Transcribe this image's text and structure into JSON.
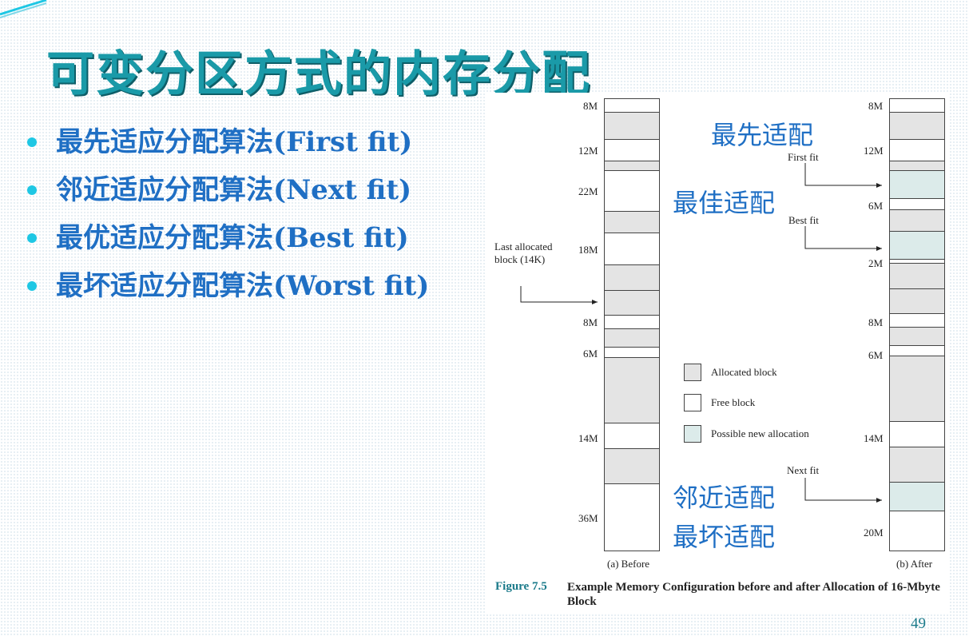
{
  "slide": {
    "title": "可变分区方式的内存分配",
    "page_number": "49",
    "bullets": [
      "最先适应分配算法(First fit)",
      "邻近适应分配算法(Next fit)",
      "最优适应分配算法(Best fit)",
      "最坏适应分配算法(Worst fit)"
    ],
    "overlay_labels": {
      "first": "最先适配",
      "best": "最佳适配",
      "next": "邻近适配",
      "worst": "最坏适配"
    },
    "colors": {
      "title": "#1a9aa8",
      "bullet_text": "#1f6fc4",
      "bullet_dot": "#1ec7e4",
      "allocated": "#e4e4e4",
      "free": "#ffffff",
      "new_allocation": "#dcebea"
    }
  },
  "figure": {
    "caption_number": "Figure 7.5",
    "caption_text": "Example Memory Configuration before and after Allocation of 16-Mbyte Block",
    "before_label": "(a) Before",
    "after_label": "(b) After",
    "last_block_label": "Last allocated block (14K)",
    "arrow_labels": {
      "first_fit": "First fit",
      "best_fit": "Best fit",
      "next_fit": "Next fit"
    },
    "legend": [
      {
        "type": "alloc",
        "label": "Allocated block"
      },
      {
        "type": "free",
        "label": "Free block"
      },
      {
        "type": "newalloc",
        "label": "Possible new allocation"
      }
    ],
    "before_size_labels": [
      "8M",
      "12M",
      "22M",
      "18M",
      "8M",
      "6M",
      "14M",
      "36M"
    ],
    "after_size_labels": [
      "8M",
      "12M",
      "6M",
      "2M",
      "8M",
      "6M",
      "14M",
      "20M"
    ],
    "before_segments": [
      {
        "type": "free",
        "size": "8M"
      },
      {
        "type": "alloc"
      },
      {
        "type": "free",
        "size": "12M"
      },
      {
        "type": "alloc"
      },
      {
        "type": "free",
        "size": "22M"
      },
      {
        "type": "alloc"
      },
      {
        "type": "free",
        "size": "18M"
      },
      {
        "type": "alloc"
      },
      {
        "type": "alloc"
      },
      {
        "type": "free",
        "size": "8M"
      },
      {
        "type": "alloc"
      },
      {
        "type": "free",
        "size": "6M"
      },
      {
        "type": "alloc"
      },
      {
        "type": "free",
        "size": "14M"
      },
      {
        "type": "alloc"
      },
      {
        "type": "free",
        "size": "36M"
      }
    ],
    "after_segments": [
      {
        "type": "free",
        "size": "8M"
      },
      {
        "type": "alloc"
      },
      {
        "type": "free",
        "size": "12M"
      },
      {
        "type": "alloc"
      },
      {
        "type": "newalloc"
      },
      {
        "type": "free",
        "size": "6M"
      },
      {
        "type": "alloc"
      },
      {
        "type": "newalloc"
      },
      {
        "type": "free",
        "size": "2M"
      },
      {
        "type": "alloc"
      },
      {
        "type": "alloc"
      },
      {
        "type": "free",
        "size": "8M"
      },
      {
        "type": "alloc"
      },
      {
        "type": "free",
        "size": "6M"
      },
      {
        "type": "alloc"
      },
      {
        "type": "free",
        "size": "14M"
      },
      {
        "type": "alloc"
      },
      {
        "type": "newalloc"
      },
      {
        "type": "free",
        "size": "20M"
      }
    ]
  }
}
